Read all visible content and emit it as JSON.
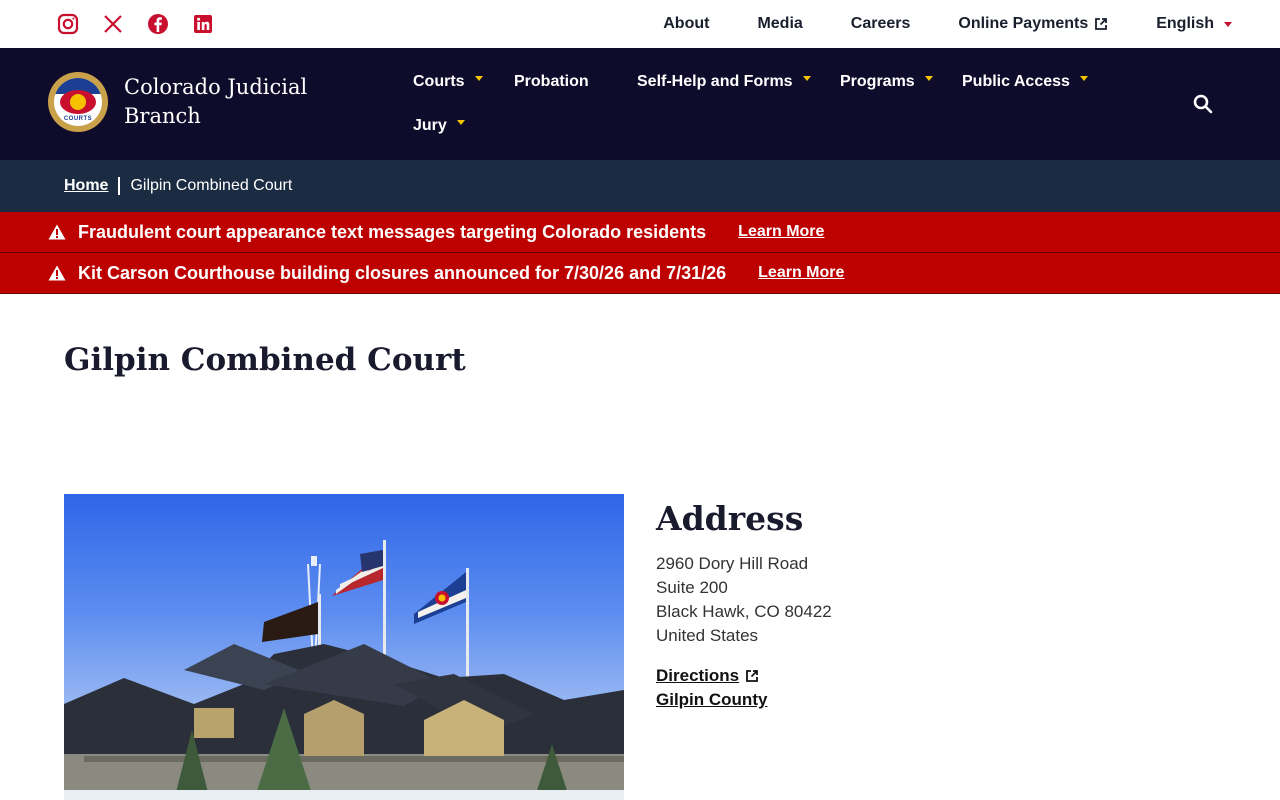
{
  "social": [
    {
      "name": "instagram-icon"
    },
    {
      "name": "x-icon"
    },
    {
      "name": "facebook-icon"
    },
    {
      "name": "linkedin-icon"
    }
  ],
  "utility_nav": {
    "about": "About",
    "media": "Media",
    "careers": "Careers",
    "online_payments": "Online Payments",
    "language": "English"
  },
  "brand": {
    "seal_text": "COURTS",
    "name": "Colorado Judicial Branch"
  },
  "main_nav": {
    "courts": "Courts",
    "probation": "Probation",
    "self_help": "Self-Help and Forms",
    "programs": "Programs",
    "public_access": "Public Access",
    "jury": "Jury"
  },
  "breadcrumb": {
    "home": "Home",
    "current": "Gilpin Combined Court"
  },
  "alerts": [
    {
      "message": "Fraudulent court appearance text messages targeting Colorado residents",
      "link": "Learn More"
    },
    {
      "message": "Kit Carson Courthouse building closures announced for 7/30/26 and 7/31/26",
      "link": "Learn More"
    }
  ],
  "page": {
    "title": "Gilpin Combined Court"
  },
  "address": {
    "heading": "Address",
    "line1": "2960 Dory Hill Road",
    "line2": "Suite 200",
    "line3": "Black Hawk, CO 80422",
    "line4": "United States",
    "directions": "Directions",
    "county": "Gilpin County"
  },
  "colors": {
    "header_bg": "#0e0c2a",
    "breadcrumb_bg": "#1a2b42",
    "alert_bg": "#bd0000",
    "accent_red": "#c8102e",
    "accent_gold": "#f6c200"
  }
}
